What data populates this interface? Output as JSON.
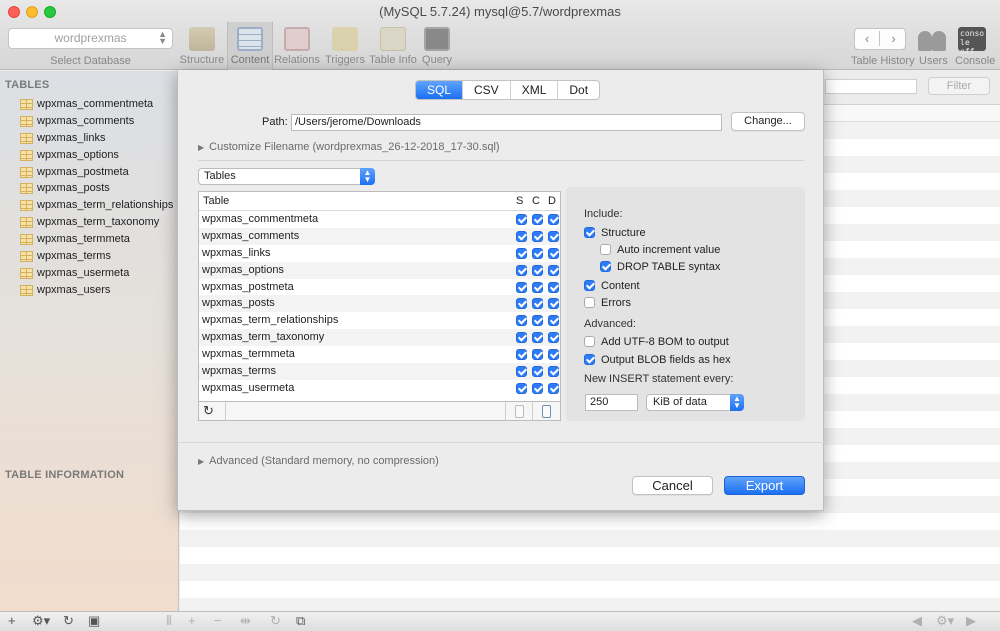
{
  "window": {
    "title": "(MySQL 5.7.24) mysql@5.7/wordprexmas"
  },
  "toolbar": {
    "database_value": "wordprexmas",
    "database_caption": "Select Database",
    "buttons": [
      "Structure",
      "Content",
      "Relations",
      "Triggers",
      "Table Info",
      "Query"
    ],
    "active": "Content",
    "right": {
      "history": "Table History",
      "users": "Users",
      "console": "Console",
      "console_icon_text": "conso\nle off"
    }
  },
  "sidebar": {
    "tables_header": "TABLES",
    "info_header": "TABLE INFORMATION",
    "tables": [
      "wpxmas_commentmeta",
      "wpxmas_comments",
      "wpxmas_links",
      "wpxmas_options",
      "wpxmas_postmeta",
      "wpxmas_posts",
      "wpxmas_term_relationships",
      "wpxmas_term_taxonomy",
      "wpxmas_termmeta",
      "wpxmas_terms",
      "wpxmas_usermeta",
      "wpxmas_users"
    ]
  },
  "filter": {
    "button": "Filter"
  },
  "export": {
    "formats": [
      "SQL",
      "CSV",
      "XML",
      "Dot"
    ],
    "selected_format": "SQL",
    "path_label": "Path:",
    "path_value": "/Users/jerome/Downloads",
    "change_button": "Change...",
    "customize_filename": "Customize Filename (wordprexmas_26-12-2018_17-30.sql)",
    "source_popup": "Tables",
    "table": {
      "header_table": "Table",
      "header_s": "S",
      "header_c": "C",
      "header_d": "D",
      "rows": [
        "wpxmas_commentmeta",
        "wpxmas_comments",
        "wpxmas_links",
        "wpxmas_options",
        "wpxmas_postmeta",
        "wpxmas_posts",
        "wpxmas_term_relationships",
        "wpxmas_term_taxonomy",
        "wpxmas_termmeta",
        "wpxmas_terms",
        "wpxmas_usermeta"
      ]
    },
    "options": {
      "include_label": "Include:",
      "structure": {
        "label": "Structure",
        "checked": true
      },
      "auto_increment": {
        "label": "Auto increment value",
        "checked": false
      },
      "drop_table": {
        "label": "DROP TABLE syntax",
        "checked": true
      },
      "content": {
        "label": "Content",
        "checked": true
      },
      "errors": {
        "label": "Errors",
        "checked": false
      },
      "advanced_label": "Advanced:",
      "utf8_bom": {
        "label": "Add UTF-8 BOM to output",
        "checked": false
      },
      "blob_hex": {
        "label": "Output BLOB fields as hex",
        "checked": true
      },
      "insert_label": "New INSERT statement every:",
      "insert_value": "250",
      "insert_unit": "KiB of data"
    },
    "advanced_disclosure": "Advanced (Standard memory, no compression)",
    "cancel_button": "Cancel",
    "export_button": "Export"
  },
  "colors": {
    "accent": "#1b6ff2",
    "close": "#fc5f57",
    "minimize": "#fdbc2e",
    "zoom": "#29c840"
  }
}
